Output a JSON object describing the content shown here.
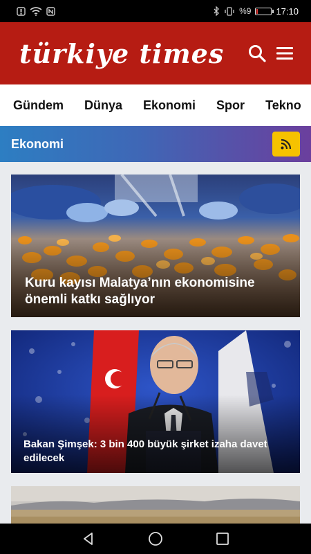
{
  "status_bar": {
    "time": "17:10",
    "battery_text": "%9",
    "battery_level": 0.09,
    "colors": {
      "battery_low": "#e53935"
    }
  },
  "header": {
    "logo_text": "türkiye times",
    "brand_color": "#b61c13"
  },
  "categories": [
    "Gündem",
    "Dünya",
    "Ekonomi",
    "Spor",
    "Tekno"
  ],
  "section": {
    "title": "Ekonomi",
    "rss_color": "#f6c200"
  },
  "articles": [
    {
      "title": "Kuru kayısı Malatya’nın ekonomisine önemli katkı sağlıyor"
    },
    {
      "title": "Bakan Şimşek: 3 bin 400 büyük şirket izaha davet edilecek"
    }
  ]
}
